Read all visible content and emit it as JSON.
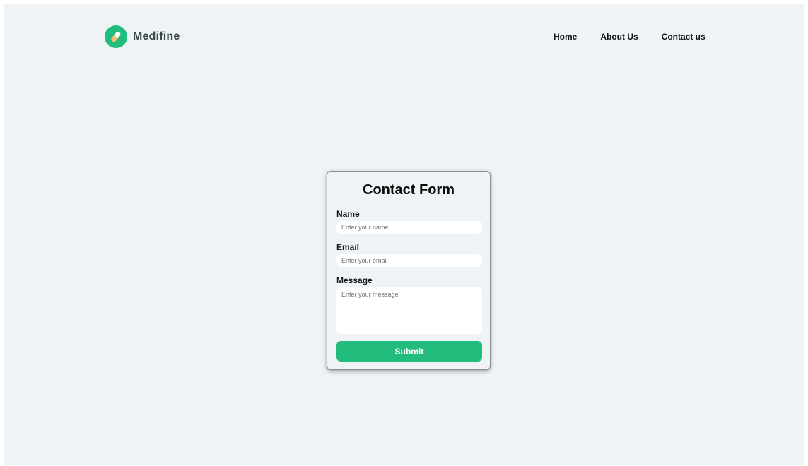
{
  "brand": {
    "name": "Medifine",
    "icon": "pill-icon",
    "accent_color": "#22bd7d"
  },
  "nav": {
    "items": [
      {
        "label": "Home"
      },
      {
        "label": "About Us"
      },
      {
        "label": "Contact us"
      }
    ]
  },
  "form": {
    "title": "Contact Form",
    "name": {
      "label": "Name",
      "placeholder": "Enter your name",
      "value": ""
    },
    "email": {
      "label": "Email",
      "placeholder": "Enter your email",
      "value": ""
    },
    "message": {
      "label": "Message",
      "placeholder": "Enter your message",
      "value": ""
    },
    "submit_label": "Submit",
    "submit_color": "#22bd7d"
  }
}
